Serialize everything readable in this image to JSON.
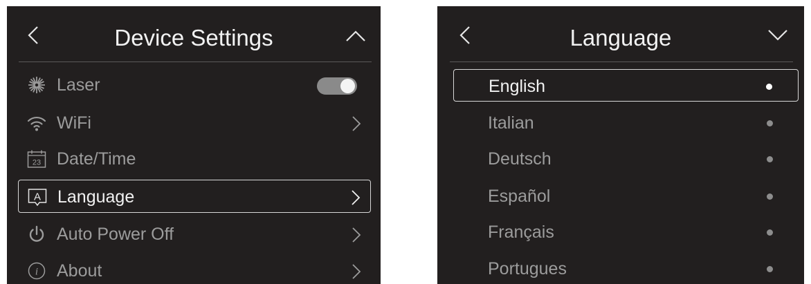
{
  "device_settings": {
    "title": "Device Settings",
    "back_icon": "chevron-left-icon",
    "collapse_icon": "chevron-up-icon",
    "items": [
      {
        "label": "Laser",
        "icon": "laser-icon",
        "control": "toggle",
        "toggle_on": true
      },
      {
        "label": "WiFi",
        "icon": "wifi-icon",
        "control": "chevron"
      },
      {
        "label": "Date/Time",
        "icon": "calendar-icon",
        "control": "none",
        "icon_text": "23"
      },
      {
        "label": "Language",
        "icon": "language-icon",
        "control": "chevron",
        "selected": true,
        "icon_text": "A"
      },
      {
        "label": "Auto Power Off",
        "icon": "power-icon",
        "control": "chevron"
      },
      {
        "label": "About",
        "icon": "info-icon",
        "control": "chevron",
        "icon_text": "i"
      }
    ]
  },
  "language": {
    "title": "Language",
    "back_icon": "chevron-left-icon",
    "expand_icon": "chevron-down-icon",
    "options": [
      {
        "label": "English",
        "selected": true
      },
      {
        "label": "Italian"
      },
      {
        "label": "Deutsch"
      },
      {
        "label": "Español"
      },
      {
        "label": "Français"
      },
      {
        "label": "Portugues"
      }
    ]
  },
  "colors": {
    "panel_bg": "#221f1f",
    "text_active": "#f2f2f2",
    "text_inactive": "#9c9c9c",
    "separator": "#5b5a5a"
  }
}
